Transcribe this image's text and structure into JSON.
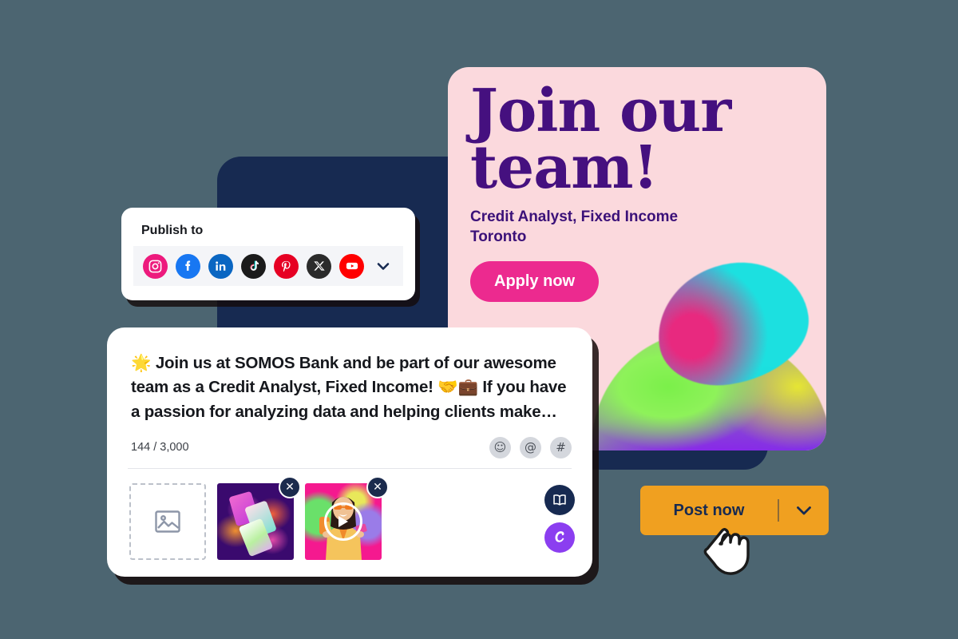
{
  "background_color": "#4c6571",
  "creative": {
    "title": "Join our\nteam!",
    "job_title": "Credit Analyst, Fixed Income",
    "location": "Toronto",
    "cta_label": "Apply now",
    "card_bg": "#fbd9dd",
    "title_color": "#45107f",
    "cta_color": "#ec2a8f"
  },
  "publish": {
    "label": "Publish to",
    "networks": [
      {
        "name": "instagram-icon",
        "label": "Instagram",
        "color": "#ed1a7d"
      },
      {
        "name": "facebook-icon",
        "label": "Facebook",
        "color": "#1877f2"
      },
      {
        "name": "linkedin-icon",
        "label": "LinkedIn",
        "color": "#0a66c2"
      },
      {
        "name": "tiktok-icon",
        "label": "TikTok",
        "color": "#1b1b1b"
      },
      {
        "name": "pinterest-icon",
        "label": "Pinterest",
        "color": "#e60023"
      },
      {
        "name": "x-icon",
        "label": "X",
        "color": "#2b2b2b"
      },
      {
        "name": "youtube-icon",
        "label": "YouTube",
        "color": "#ff0000"
      }
    ],
    "expand_label": "Show more networks"
  },
  "composer": {
    "post_text": "🌟 Join us at SOMOS Bank and be part of our awesome team as a Credit Analyst, Fixed Income! 🤝💼 If you have a passion for analyzing data and helping clients make…",
    "char_count": "144 / 3,000",
    "meta_icons": [
      {
        "name": "emoji-icon",
        "glyph": "☺",
        "label": "Insert emoji"
      },
      {
        "name": "mention-icon",
        "glyph": "@",
        "label": "Mention"
      },
      {
        "name": "hashtag-icon",
        "glyph": "#",
        "label": "Hashtag"
      }
    ],
    "add_media_label": "Add media",
    "attachments": [
      {
        "name": "image-attachment",
        "type": "image",
        "remove_label": "✕"
      },
      {
        "name": "video-attachment",
        "type": "video",
        "remove_label": "✕"
      }
    ],
    "tools": [
      {
        "name": "content-library-icon",
        "label": "Content library",
        "color": "#172a51"
      },
      {
        "name": "canva-icon",
        "label": "Canva",
        "color": "#8b3ef0"
      }
    ]
  },
  "post_button": {
    "label": "Post now",
    "caret_label": "More posting options",
    "color": "#f0a020",
    "text_color": "#172a51"
  },
  "cursor": {
    "name": "pointer-hand-cursor"
  }
}
